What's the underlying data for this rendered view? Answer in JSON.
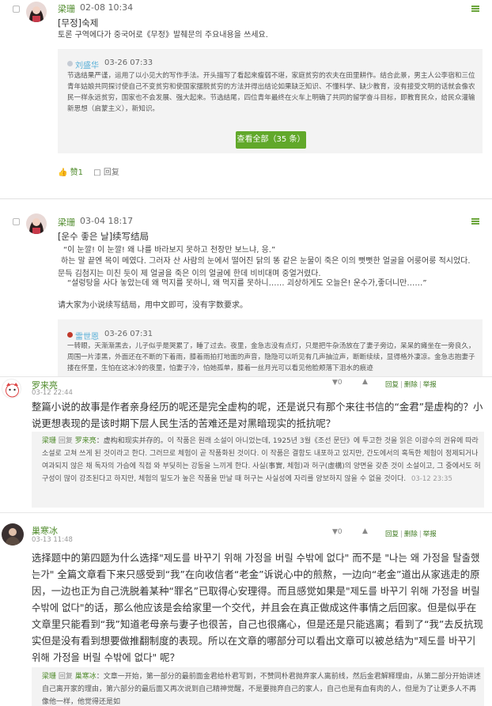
{
  "posts": [
    {
      "author": "梁珊",
      "time": "02-08 10:34",
      "title": "[무정]숙제",
      "content": "토론 구역에다가 중국어로《무정》발췌문의 주요내용을 쓰세요.",
      "quote": {
        "author": "刘盛华",
        "time": "03-26 07:33",
        "text": "节选结果严谨，运用了以小见大的写作手法。开头描写了看起来瘦弱不堪，家庭贫穷的农夫在田里耕作。结合此景，男主人公李宿和三位青年姑娘共同探讨使自己不变贫穷和使国家摆脱贫穷的方法并得出结论如果缺乏知识、不懂科学、缺少教育，没有接受文明的话就会像农民一样永远贫穷，国家也不会发展、强大起来。节选结尾，四位青年最终在火车上明确了共同的留学奋斗目标，即教育民众，给民众灌输新思想（启蒙主义），新知识。"
      },
      "view_all": "查看全部（35 条）",
      "like_label": "赞1",
      "reply_label": "回复"
    },
    {
      "author": "梁珊",
      "time": "03-04 18:17",
      "title": "[운수 좋은 날]续写结局",
      "lines": [
        "“이 눈깔! 이 눈깔! 왜 나를 바라보지 못하고 천장만 보느냐, 응.”",
        "하는 말 끝엔 목이 메였다. 그러자 산 사람의 눈에서 떨어진 닭의 똥 같은 눈물이 죽은 이의 뻣뻣한 얼굴을 어룽어룽 적시었다. 문득 김첨지는 미친 듯이 제 얼굴을 죽은 이의 얼굴에 한데 비비대며 중얼거렸다.",
        "“설렁탕을 사다 놓았는데 왜 먹지를 못하니, 왜 먹지를 못하니…… 괴상하게도 오늘은! 운수가,좋더니만……”"
      ],
      "instruction": "请大家为小说续写结局，用中文即可，没有字数要求。",
      "quote": {
        "author": "雷世恩",
        "time": "03-26 07:31",
        "text": "一转眼，天渐渐黑去，儿子似乎是哭累了，睡了过去。夜里，金急志没有点灯，只是把牛杂汤放在了妻子旁边，呆呆的瘫坐在一旁良久，周围一片漆黑，外面还在不断的下着雨，膝着雨拍打地面的声音，隐隐可以听见有几声抽泣声，断断续续，显得格外凄凉。金急志抱妻子搂在怀里，生怕在这冰冷的夜里，怕妻子冷，怕她孤单，膝着一丝月光可以看见他脸颊落下泪水的痕迹"
      }
    }
  ],
  "comments": [
    {
      "author": "罗来亮",
      "time": "03-12 22:44",
      "vote": "0",
      "ops": [
        "回复",
        "删除",
        "举报"
      ],
      "text": "整篇小说的故事是作者亲身经历的呢还是完全虚构的呢，还是说只有那个来往书信的“金君”是虚构的？小说更想表现的是该时期下层人民生活的苦难还是对黑暗现实的抵抗呢？",
      "reply": {
        "from": "梁珊",
        "verb": "回复",
        "to": "罗来亮",
        "text": "：虚构和现实并存的。이 작품은 원래 소설이 아니었는데, 1925년 3월《조선 문단》에 투고한 것을 읽은 이광수의 권유에 따라 소설로 고쳐 쓰게 된 것이라고 한다. 그러므로 체험이 곧 작품화된 것이다. 이 작품은 결함도 내포하고 있지만, 간도에서의 혹독한 체험이 정제되거나 여과되지 않은 채 독자의 가슴에 직접 와 부딪히는 강동을 느끼게 한다. 사실(事實, 체험)과 허구(虛構)의 양면을 갖춘 것이 소설이고, 그 중에서도 허구성이 많이 강조된다고 하지만, 체험의 밑도가 높은 작품을 만날 때 허구는 사실성에 자리를 양보하지 않을 수 없을 것이다.",
        "time": "03-12 23:35"
      }
    },
    {
      "author": "巢寒冰",
      "time": "03-13 11:48",
      "vote": "0",
      "ops": [
        "回复",
        "删除",
        "举报"
      ],
      "text": "选择题中的第四题为什么选择\"제도를 바꾸기 위해 가정을 버릴 수밖에 없다\" 而不是 \"나는 왜 가정을 탈출했는가\" 全篇文章看下来只感受到“我”在向收信者“老金”诉说心中的煎熬，一边向“老金”道出从家逃走的原因，一边也正为自己洗脱着某种“罪名”已取得心安理得。而且感觉如果是\"제도를 바꾸기 위해 가정을 버릴 수밖에 없다\"的话，那么他应该是会给家里一个交代，并且会在真正做成这件事情之后回家。但是似乎在文章里只能看到“我”知道老母亲与妻子也很苦，自己也很痛心，但是还是只能逃离；看到了“我”去反抗现实但是没有看到想要做推翻制度的表现。所以在文章的哪部分可以看出文章可以被总结为\"제도를 바꾸기 위해 가정을 버릴 수밖에 없다\" 呢？",
      "reply": {
        "from": "梁珊",
        "verb": "回复",
        "to": "巢寒冰",
        "text": "：文章一开始，第一部分的最前面金君给朴君写到，不赞同朴君抛弃家人离前线，然后金君解释理由，从第二部分开始讲述自己离开家的理由，第六部分的最后面又再次说到自己精神觉醒，不是要抛弃自己的家人，自己也是有血有肉的人，但是为了让更多人不再像他一样，他觉得还是如"
      }
    }
  ]
}
